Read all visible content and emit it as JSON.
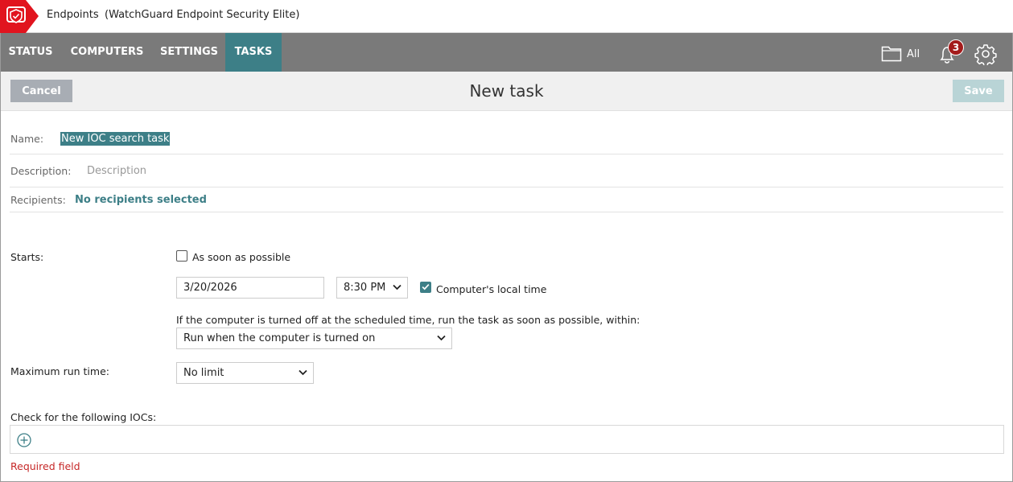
{
  "header": {
    "app_name": "Endpoints",
    "app_edition": "(WatchGuard Endpoint Security Elite)",
    "logo_icon": "shield-check-icon",
    "brand_color": "#e1141e"
  },
  "nav": {
    "tabs": [
      {
        "label": "STATUS"
      },
      {
        "label": "COMPUTERS"
      },
      {
        "label": "SETTINGS"
      },
      {
        "label": "TASKS",
        "active": true
      }
    ],
    "folder_icon": "folder-icon",
    "filter_label": "All",
    "notification_icon": "bell-icon",
    "notification_count": "3",
    "settings_icon": "gear-icon",
    "active_color": "#3d7f87",
    "bar_color": "#7a7a7a"
  },
  "actions": {
    "cancel_label": "Cancel",
    "title": "New task",
    "save_label": "Save"
  },
  "form": {
    "name_label": "Name:",
    "name_value": "New IOC search task",
    "description_label": "Description:",
    "description_placeholder": "Description",
    "recipients_label": "Recipients:",
    "recipients_value": "No recipients selected",
    "starts_label": "Starts:",
    "asap_label": "As soon as possible",
    "asap_checked": false,
    "date_value": "3/20/2026",
    "time_value": "8:30 PM",
    "local_time_label": "Computer's local time",
    "local_time_checked": true,
    "offline_text": "If the computer is turned off at the scheduled time, run the task as soon as possible, within:",
    "offline_select_value": "Run when the computer is turned on",
    "max_run_label": "Maximum run time:",
    "max_run_value": "No limit",
    "iocs_label": "Check for the following IOCs:",
    "add_icon": "plus-circle-icon",
    "required_text": "Required field",
    "error_color": "#c62828"
  }
}
